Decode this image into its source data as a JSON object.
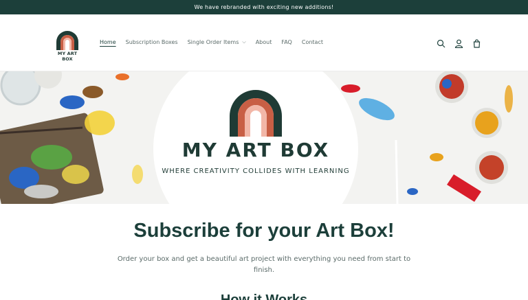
{
  "announcement": {
    "text": "We have rebranded with exciting new additions!"
  },
  "header": {
    "logo_text": "MY ART BOX",
    "nav": [
      {
        "label": "Home",
        "active": true
      },
      {
        "label": "Subscription Boxes"
      },
      {
        "label": "Single Order Items",
        "has_dropdown": true
      },
      {
        "label": "About"
      },
      {
        "label": "FAQ"
      },
      {
        "label": "Contact"
      }
    ],
    "icons": [
      "search-icon",
      "account-icon",
      "cart-icon"
    ]
  },
  "hero": {
    "title": "MY ART BOX",
    "tagline": "WHERE CREATIVITY COLLIDES WITH LEARNING"
  },
  "main": {
    "title": "Subscribe for your Art Box!",
    "subtitle": "Order your box and get a beautiful art project with everything you need from start to finish.",
    "next_heading": "How it Works"
  },
  "colors": {
    "brand_dark": "#1c3f3a",
    "rainbow_outer": "#1f3b35",
    "rainbow_mid": "#c85f45",
    "rainbow_inner": "#f2b7a8"
  }
}
